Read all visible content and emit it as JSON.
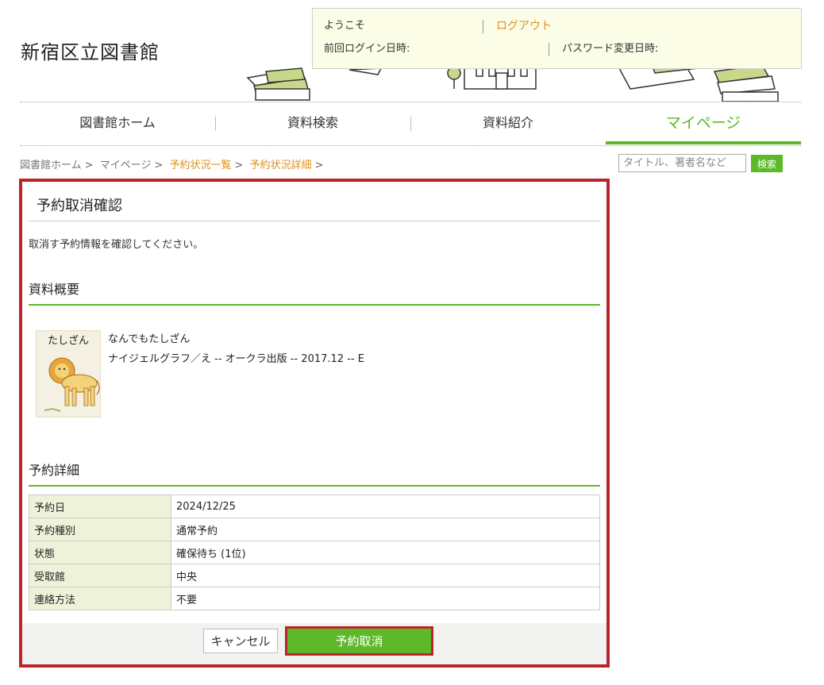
{
  "header": {
    "site_title": "新宿区立図書館",
    "welcome_label": "ようこそ",
    "logout_label": "ログアウト",
    "last_login_label": "前回ログイン日時:",
    "password_change_label": "パスワード変更日時:"
  },
  "nav": {
    "items": [
      {
        "label": "図書館ホーム"
      },
      {
        "label": "資料検索"
      },
      {
        "label": "資料紹介"
      },
      {
        "label": "マイページ"
      }
    ]
  },
  "breadcrumb": {
    "items": [
      "図書館ホーム",
      "マイページ",
      "予約状況一覧",
      "予約状況詳細"
    ]
  },
  "search": {
    "placeholder": "タイトル、著者名など",
    "button_label": "検索"
  },
  "main": {
    "title": "予約取消確認",
    "intro": "取消す予約情報を確認してください。",
    "material_section_title": "資料概要",
    "book": {
      "cover_title": "たしざん",
      "title": "なんでもたしざん",
      "meta": "ナイジェルグラフ／え -- オークラ出版 -- 2017.12 -- E"
    },
    "detail_section_title": "予約詳細",
    "details": [
      {
        "label": "予約日",
        "value": "2024/12/25"
      },
      {
        "label": "予約種別",
        "value": "通常予約"
      },
      {
        "label": "状態",
        "value": "確保待ち (1位)"
      },
      {
        "label": "受取館",
        "value": "中央"
      },
      {
        "label": "連絡方法",
        "value": "不要"
      }
    ],
    "cancel_button": "キャンセル",
    "confirm_button": "予約取消"
  },
  "colors": {
    "accent_green": "#5db82a",
    "highlight_red": "#b8262b",
    "link_orange": "#e0901a"
  }
}
